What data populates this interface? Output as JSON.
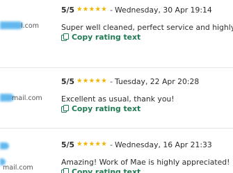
{
  "colors": {
    "star": "#f0b400",
    "link": "#1f7a52",
    "redaction": "#62b8ee",
    "divider": "#e3e3e3"
  },
  "reviews": [
    {
      "email_suffix": "l.com",
      "score": "5/5",
      "stars": 5,
      "separator": "-",
      "date": "Wednesday, 30 Apr 19:14",
      "comment": "Super well cleaned, perfect service and highly recommend",
      "copy_label": "Copy rating text",
      "copy_icon": "copy-icon"
    },
    {
      "email_suffix": "mail.com",
      "score": "5/5",
      "stars": 5,
      "separator": "-",
      "date": "Tuesday, 22 Apr 20:28",
      "comment": "Excellent as usual, thank you!",
      "copy_label": "Copy rating text",
      "copy_icon": "copy-icon"
    },
    {
      "email_suffix": "mail.com",
      "score": "5/5",
      "stars": 5,
      "separator": "-",
      "date": "Wednesday, 16 Apr 21:33",
      "comment": "Amazing! Work of Mae is highly appreciated!",
      "copy_label": "Copy rating text",
      "copy_icon": "copy-icon"
    }
  ]
}
